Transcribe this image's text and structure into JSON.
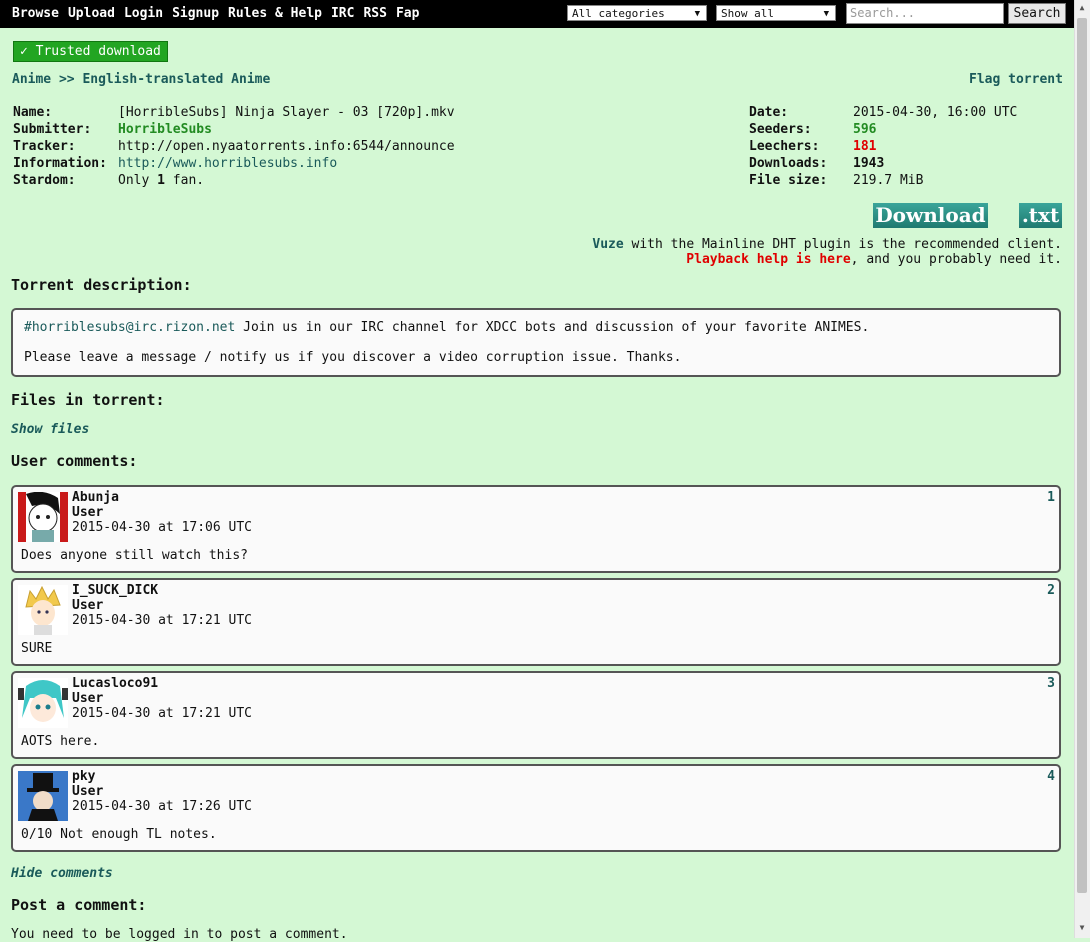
{
  "nav": [
    "Browse",
    "Upload",
    "Login",
    "Signup",
    "Rules & Help",
    "IRC",
    "RSS",
    "Fap"
  ],
  "filters": {
    "category": "All categories",
    "show": "Show all"
  },
  "search": {
    "placeholder": "Search...",
    "button": "Search"
  },
  "trusted": "✓ Trusted download",
  "breadcrumb": {
    "cat": "Anime",
    "sep": ">>",
    "sub": "English-translated Anime"
  },
  "flag": "Flag torrent",
  "details_left": [
    {
      "label": "Name:",
      "value": "[HorribleSubs] Ninja Slayer - 03 [720p].mkv"
    },
    {
      "label": "Submitter:",
      "value": "HorribleSubs"
    },
    {
      "label": "Tracker:",
      "value": "http://open.nyaatorrents.info:6544/announce"
    },
    {
      "label": "Information:",
      "value": "http://www.horriblesubs.info"
    },
    {
      "label": "Stardom:",
      "value_pre": "Only ",
      "value_bold": "1",
      "value_post": " fan."
    }
  ],
  "details_right": [
    {
      "label": "Date:",
      "value": "2015-04-30, 16:00 UTC"
    },
    {
      "label": "Seeders:",
      "value": "596"
    },
    {
      "label": "Leechers:",
      "value": "181"
    },
    {
      "label": "Downloads:",
      "value": "1943"
    },
    {
      "label": "File size:",
      "value": "219.7 MiB"
    }
  ],
  "buttons": {
    "download": "Download",
    "txt": ".txt"
  },
  "client": {
    "vuze": "Vuze",
    "line1_rest": " with the Mainline DHT plugin is the recommended client.",
    "playback": "Playback help is here",
    "line2_rest": ", and you probably need it."
  },
  "headings": {
    "description": "Torrent description:",
    "files": "Files in torrent:",
    "comments": "User comments:",
    "post": "Post a comment:"
  },
  "description": {
    "irc": "#horriblesubs@irc.rizon.net",
    "line1_rest": " Join us in our IRC channel for XDCC bots and discussion of your favorite ANIMES.",
    "line2": "Please leave a message / notify us if you discover a video corruption issue. Thanks."
  },
  "show_files": "Show files",
  "hide_comments": "Hide comments",
  "comments": [
    {
      "user": "Abunja",
      "role": "User",
      "time": "2015-04-30 at 17:06 UTC",
      "num": "1",
      "text": "Does anyone still watch this?"
    },
    {
      "user": "I_SUCK_DICK",
      "role": "User",
      "time": "2015-04-30 at 17:21 UTC",
      "num": "2",
      "text": "SURE"
    },
    {
      "user": "Lucasloco91",
      "role": "User",
      "time": "2015-04-30 at 17:21 UTC",
      "num": "3",
      "text": "AOTS here."
    },
    {
      "user": "pky",
      "role": "User",
      "time": "2015-04-30 at 17:26 UTC",
      "num": "4",
      "text": "0/10 Not enough TL notes."
    }
  ],
  "login_note": "You need to be logged in to post a comment."
}
